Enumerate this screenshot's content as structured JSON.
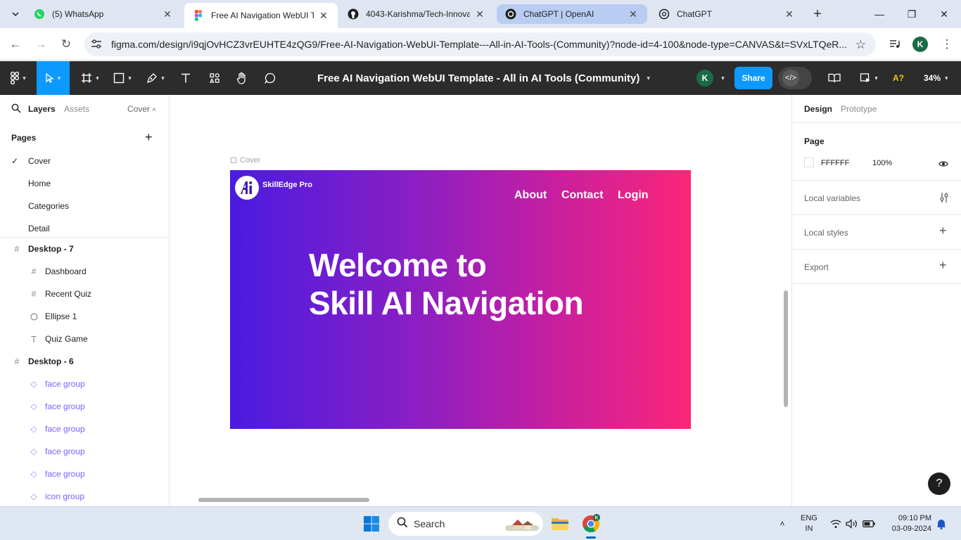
{
  "browser": {
    "tabs": [
      {
        "title": "(5) WhatsApp",
        "icon": "whatsapp-icon"
      },
      {
        "title": "Free AI Navigation WebUI Te",
        "icon": "figma-icon",
        "active": true
      },
      {
        "title": "4043-Karishma/Tech-Innova",
        "icon": "github-icon"
      },
      {
        "title": "ChatGPT | OpenAI",
        "icon": "openai-icon",
        "highlighted": true
      },
      {
        "title": "ChatGPT",
        "icon": "openai-icon"
      }
    ],
    "url": "figma.com/design/i9qjOvHCZ3vrEUHTE4zQG9/Free-AI-Navigation-WebUI-Template---All-in-AI-Tools-(Community)?node-id=4-100&node-type=CANVAS&t=SVxLTQeR...",
    "profile_initial": "K"
  },
  "figma": {
    "doc_title": "Free AI Navigation WebUI Template - All in AI Tools (Community)",
    "user_initial": "K",
    "share_label": "Share",
    "zoom": "34%",
    "font_badge": "A?"
  },
  "left_panel": {
    "tabs": {
      "layers": "Layers",
      "assets": "Assets"
    },
    "current_page": "Cover",
    "pages_label": "Pages",
    "pages": [
      "Cover",
      "Home",
      "Categories",
      "Detail"
    ],
    "layers": [
      {
        "name": "Desktop - 7",
        "kind": "frame"
      },
      {
        "name": "Dashboard",
        "kind": "frame-child"
      },
      {
        "name": "Recent Quiz",
        "kind": "frame-child"
      },
      {
        "name": "Ellipse 1",
        "kind": "ellipse"
      },
      {
        "name": "Quiz Game",
        "kind": "text"
      },
      {
        "name": "Desktop - 6",
        "kind": "frame"
      },
      {
        "name": "face group",
        "kind": "component"
      },
      {
        "name": "face group",
        "kind": "component"
      },
      {
        "name": "face group",
        "kind": "component"
      },
      {
        "name": "face group",
        "kind": "component"
      },
      {
        "name": "face group",
        "kind": "component"
      },
      {
        "name": "icon group",
        "kind": "component"
      }
    ]
  },
  "canvas": {
    "frame_label": "Cover",
    "cover": {
      "brand": "SkillEdge Pro",
      "nav": [
        "About",
        "Contact",
        "Login"
      ],
      "headline_line1": "Welcome to",
      "headline_line2": "Skill AI Navigation",
      "gradient_start": "#4a1be0",
      "gradient_end": "#fb2677"
    }
  },
  "right_panel": {
    "tabs": {
      "design": "Design",
      "prototype": "Prototype"
    },
    "page_label": "Page",
    "page_color": "FFFFFF",
    "page_opacity": "100%",
    "sections": [
      "Local variables",
      "Local styles",
      "Export"
    ]
  },
  "taskbar": {
    "search_label": "Search",
    "lang_line1": "ENG",
    "lang_line2": "IN",
    "time": "09:10 PM",
    "date": "03-09-2024"
  },
  "colors": {
    "figma_accent": "#0d99ff",
    "toolbar_bg": "#2c2c2c",
    "component_purple": "#7b61ff"
  }
}
